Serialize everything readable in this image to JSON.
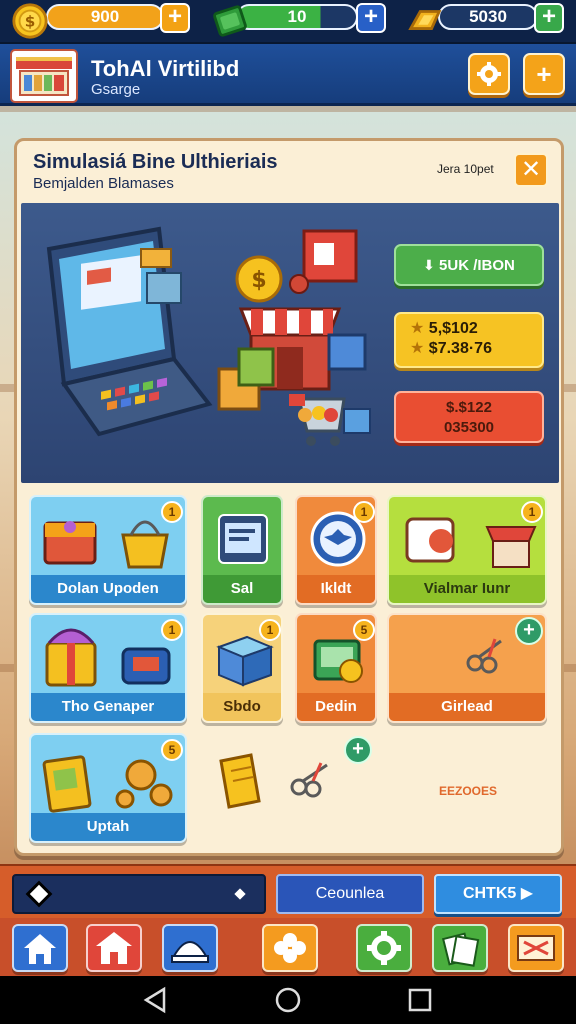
{
  "resources": {
    "coins": "900",
    "cash": "10",
    "gold": "5030",
    "plus_label": "+"
  },
  "header": {
    "title": "TohAl Virtilibd",
    "subtitle": "Gsarge",
    "button1_icon": "gear-icon",
    "button2_icon": "plus-icon",
    "plus_label": "+"
  },
  "panel": {
    "title": "Simulasiá Bine Ulthieriais",
    "subtitle": "Bemjalden Blamases",
    "page_label": "Jera 10pet",
    "close_label": "✕",
    "buy_label": "5UK /IBON",
    "price_line1": "5,$102",
    "price_line2": "$7.38·76",
    "sale_line1": "$.$122",
    "sale_line2": "035300"
  },
  "tiles": [
    {
      "label": "Dolan Upoden",
      "badge": "1"
    },
    {
      "label": "Sal"
    },
    {
      "label": "Ikldt",
      "badge": "1"
    },
    {
      "label": "Vialmar Iunr",
      "badge": "1"
    },
    {
      "label": "Tho Genaper",
      "badge": "1"
    },
    {
      "label": "Sbdo",
      "badge": "1"
    },
    {
      "label": "Dedin",
      "badge": "5"
    },
    {
      "label": "Girlead",
      "badge": "+"
    },
    {
      "label": "Uptah",
      "badge": "5"
    }
  ],
  "extra": {
    "green_badge": "+",
    "footer_text": "EEZOOES"
  },
  "bottom_bar": {
    "left_icon": "diamond-icon",
    "center_label": "Ceounlea",
    "right_label": "CHTK5",
    "right_arrow": "▶"
  },
  "nav": [
    "home-icon",
    "shop-icon",
    "dome-icon",
    "clover-icon",
    "gear-icon",
    "cards-icon",
    "map-icon"
  ],
  "colors": {
    "topbar": "#0d2247",
    "header": "#1f4f9a",
    "panel": "#fbefd6",
    "accent_orange": "#f4a319",
    "buy_green": "#4cae4a",
    "price_yellow": "#f6c323",
    "sale_red": "#e94e32"
  }
}
